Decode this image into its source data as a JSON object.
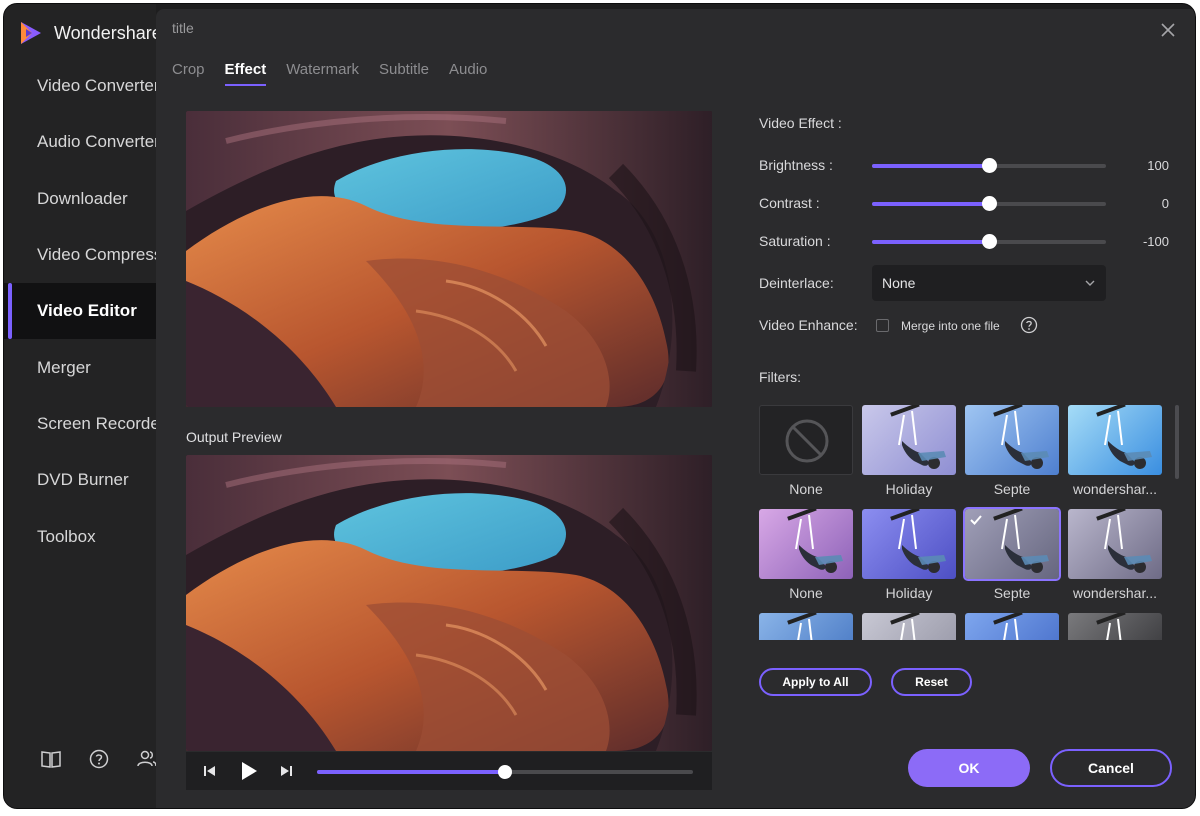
{
  "app": {
    "brand": "Wondershare"
  },
  "sidebar": {
    "items": [
      {
        "label": "Video Converter"
      },
      {
        "label": "Audio Converter"
      },
      {
        "label": "Downloader"
      },
      {
        "label": "Video Compressor"
      },
      {
        "label": "Video Editor"
      },
      {
        "label": "Merger"
      },
      {
        "label": "Screen Recorder"
      },
      {
        "label": "DVD Burner"
      },
      {
        "label": "Toolbox"
      }
    ],
    "active": "Video Editor",
    "bottom_icons": [
      "book-icon",
      "help-circle-icon",
      "users-icon"
    ]
  },
  "dialog": {
    "title": "title",
    "tabs": [
      {
        "label": "Crop"
      },
      {
        "label": "Effect"
      },
      {
        "label": "Watermark"
      },
      {
        "label": "Subtitle"
      },
      {
        "label": "Audio"
      }
    ],
    "active_tab": "Effect",
    "output_label": "Output Preview",
    "player": {
      "progress_percent": 50
    },
    "video_effect": {
      "heading": "Video Effect :",
      "brightness": {
        "label": "Brightness :",
        "value": "100",
        "level_percent": 50
      },
      "contrast": {
        "label": "Contrast :",
        "value": "0",
        "level_percent": 50
      },
      "saturation": {
        "label": "Saturation :",
        "value": "-100",
        "level_percent": 50
      },
      "deinterlace": {
        "label": "Deinterlace:",
        "selected": "None"
      },
      "enhance": {
        "label": "Video Enhance:",
        "checkbox_label": "Merge into one file",
        "checked": false
      }
    },
    "filters": {
      "heading": "Filters:",
      "items": [
        {
          "name": "None"
        },
        {
          "name": "Holiday"
        },
        {
          "name": "Septe"
        },
        {
          "name": "wondershar..."
        },
        {
          "name": "None"
        },
        {
          "name": "Holiday"
        },
        {
          "name": "Septe"
        },
        {
          "name": "wondershar..."
        },
        {
          "name": ""
        },
        {
          "name": ""
        },
        {
          "name": ""
        },
        {
          "name": ""
        }
      ],
      "selected_index": 6
    },
    "buttons": {
      "apply_all": "Apply to All",
      "reset": "Reset",
      "ok": "OK",
      "cancel": "Cancel"
    }
  },
  "colors": {
    "accent": "#7b61ff",
    "ok_button": "#8c6bf7",
    "sidebar_bg": "#232324",
    "dialog_bg": "#2b2b2d"
  }
}
